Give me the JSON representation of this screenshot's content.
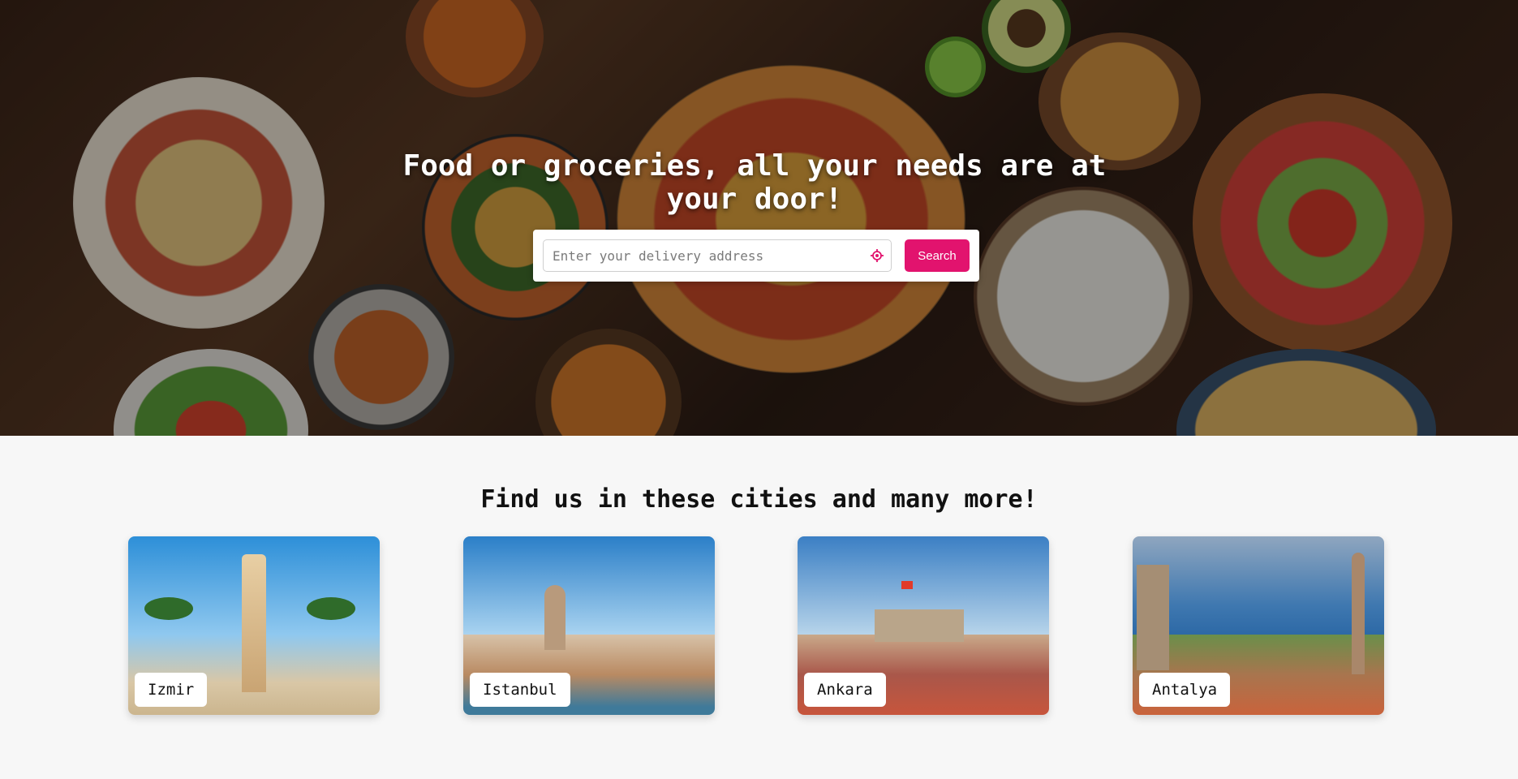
{
  "hero": {
    "title": "Food or groceries, all your needs are at your door!",
    "search": {
      "placeholder": "Enter your delivery address",
      "value": "",
      "locate_icon": "crosshair-location-icon",
      "button_label": "Search",
      "button_color": "#e2136e"
    }
  },
  "cities": {
    "title": "Find us in these cities and many more!",
    "items": [
      {
        "name": "Izmir"
      },
      {
        "name": "Istanbul"
      },
      {
        "name": "Ankara"
      },
      {
        "name": "Antalya"
      }
    ]
  }
}
